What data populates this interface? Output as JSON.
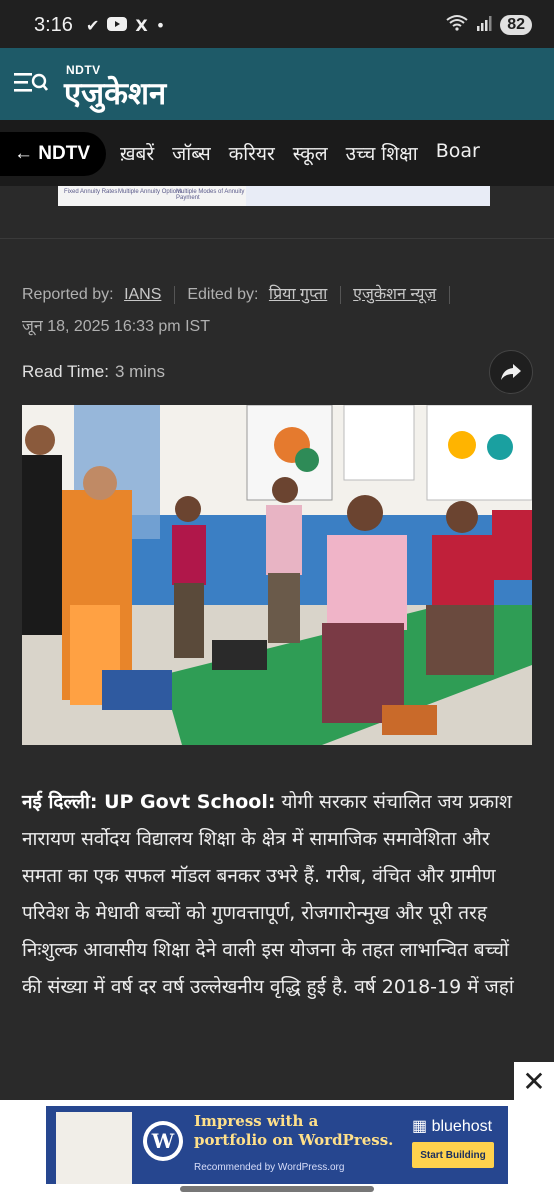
{
  "status": {
    "time": "3:16",
    "icons": [
      "check-icon",
      "youtube-icon",
      "x-icon",
      "dot-icon"
    ],
    "battery": "82"
  },
  "header": {
    "brand_small": "NDTV",
    "brand_main": "एजुकेशन",
    "accent": "#1e5a68"
  },
  "nav": {
    "home": "← NDTV",
    "items": [
      "ख़बरें",
      "जॉब्स",
      "करियर",
      "स्कूल",
      "उच्च शिक्षा",
      "Boar"
    ]
  },
  "article_meta": {
    "reported_label": "Reported by:",
    "reported_by": "IANS",
    "edited_label": "Edited by:",
    "edited_by": "प्रिया गुप्ता",
    "category": "एजुकेशन न्यूज़",
    "date": "जून 18, 2025 16:33 pm IST",
    "read_label": "Read Time:",
    "read_value": "3 mins"
  },
  "article": {
    "dateline": "नई दिल्ली: UP Govt School:",
    "body": "योगी सरकार संचालित जय प्रकाश नारायण सर्वोदय विद्यालय शिक्षा के क्षेत्र में सामाजिक समावेशिता और समता का एक सफल मॉडल बनकर उभरे हैं. गरीब, वंचित और ग्रामीण परिवेश के मेधावी बच्चों को गुणवत्तापूर्ण, रोजगारोन्मुख और पूरी तरह निःशुल्क आवासीय शिक्षा देने वाली इस योजना के तहत लाभान्वित बच्चों की संख्या में वर्ष दर वर्ष उल्लेखनीय वृद्धि हुई है. वर्ष 2018-19 में जहां"
  },
  "top_ad": {
    "texts": [
      "Fixed Annuity Rates",
      "Multiple Annuity Options",
      "Multiple Modes of Annuity Payment"
    ]
  },
  "bottom_ad": {
    "headline_1": "Impress with a",
    "headline_2": "portfolio on WordPress.",
    "sub": "Recommended by WordPress.org",
    "brand": "bluehost",
    "cta": "Start Building",
    "close": "✕"
  }
}
